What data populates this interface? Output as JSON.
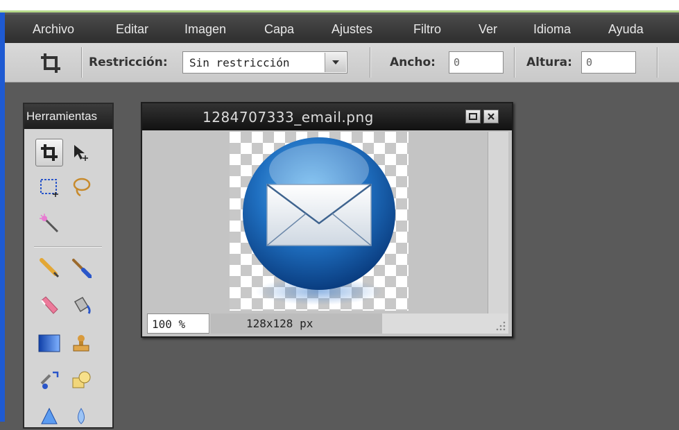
{
  "menu": {
    "items": [
      "Archivo",
      "Editar",
      "Imagen",
      "Capa",
      "Ajustes",
      "Filtro",
      "Ver",
      "Idioma",
      "Ayuda"
    ]
  },
  "toolbar": {
    "tool_icon": "crop-icon",
    "restriction_label": "Restricción:",
    "restriction_value": "Sin restricción",
    "width_label": "Ancho:",
    "width_value": "0",
    "height_label": "Altura:",
    "height_value": "0"
  },
  "tools_panel": {
    "title": "Herramientas",
    "tools": [
      "crop-icon",
      "move-icon",
      "marquee-icon",
      "lasso-icon",
      "magic-wand-icon",
      "pencil-icon",
      "brush-icon",
      "eraser-icon",
      "paint-bucket-icon",
      "gradient-icon",
      "stamp-icon",
      "color-replace-icon",
      "shape-icon",
      "sharpen-icon",
      "blur-icon"
    ]
  },
  "document": {
    "title": "1284707333_email.png",
    "zoom": "100 %",
    "size": "128x128 px",
    "image_icon": "email-envelope-icon"
  },
  "colors": {
    "menubar": "#2e2e2e",
    "accent_blue": "#1e5ad2",
    "workspace": "#5a5a5a"
  }
}
